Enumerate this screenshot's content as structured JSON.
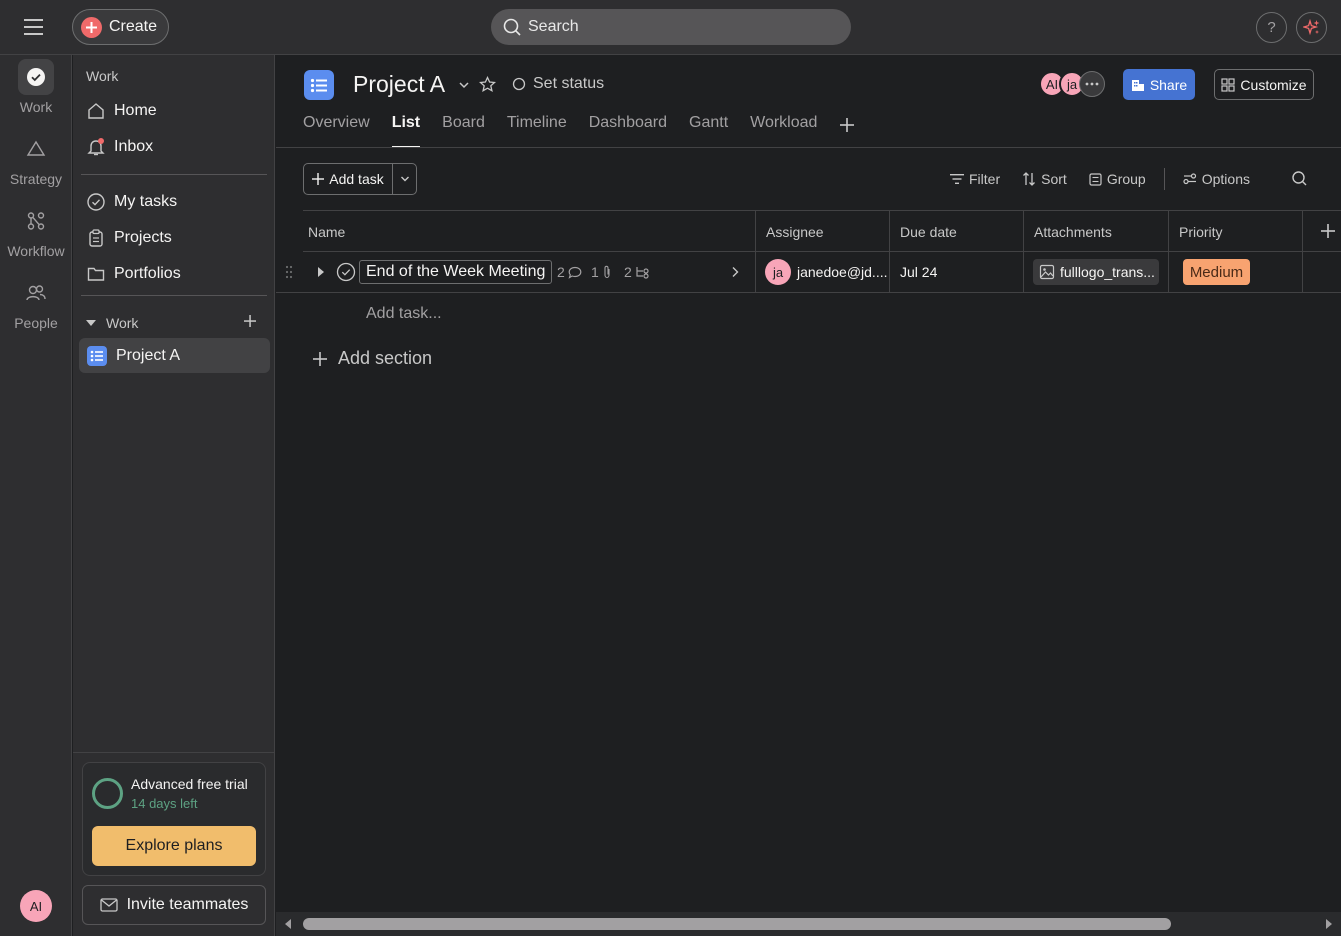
{
  "topbar": {
    "create_label": "Create",
    "search_placeholder": "Search",
    "help_label": "?"
  },
  "rail": {
    "items": [
      {
        "label": "Work",
        "icon": "check-circle-icon"
      },
      {
        "label": "Strategy",
        "icon": "triangle-icon"
      },
      {
        "label": "Workflow",
        "icon": "workflow-icon"
      },
      {
        "label": "People",
        "icon": "people-icon"
      }
    ],
    "avatar_initials": "AI"
  },
  "sidebar": {
    "heading": "Work",
    "items": [
      {
        "label": "Home",
        "icon": "home-icon"
      },
      {
        "label": "Inbox",
        "icon": "bell-icon"
      }
    ],
    "items2": [
      {
        "label": "My tasks",
        "icon": "check-circle-icon"
      },
      {
        "label": "Projects",
        "icon": "clipboard-icon"
      },
      {
        "label": "Portfolios",
        "icon": "folder-icon"
      }
    ],
    "section_label": "Work",
    "projects": [
      {
        "label": "Project A"
      }
    ],
    "trial": {
      "title": "Advanced free trial",
      "subtitle": "14 days left",
      "cta": "Explore plans"
    },
    "invite_label": "Invite teammates"
  },
  "project": {
    "title": "Project A",
    "set_status": "Set status",
    "members": [
      "AI",
      "ja"
    ],
    "share_label": "Share",
    "customize_label": "Customize",
    "tabs": [
      "Overview",
      "List",
      "Board",
      "Timeline",
      "Dashboard",
      "Gantt",
      "Workload"
    ],
    "active_tab": "List"
  },
  "toolbar": {
    "add_task_label": "Add task",
    "filter_label": "Filter",
    "sort_label": "Sort",
    "group_label": "Group",
    "options_label": "Options"
  },
  "table": {
    "columns": [
      "Name",
      "Assignee",
      "Due date",
      "Attachments",
      "Priority"
    ],
    "rows": [
      {
        "name": "End of the Week Meeting",
        "comments": "2",
        "attachments_count": "1",
        "subtasks": "2",
        "assignee_initials": "ja",
        "assignee": "janedoe@jd....",
        "due": "Jul 24",
        "attachment": "fulllogo_trans...",
        "priority": "Medium"
      }
    ],
    "add_task_placeholder": "Add task...",
    "add_section_label": "Add section"
  },
  "colors": {
    "accent_blue": "#4573d2",
    "create_red": "#f06a6a",
    "trial_green": "#5da283",
    "explore_orange": "#f1bd6c",
    "priority_medium": "#f8a370",
    "avatar_pink": "#f8a5b8"
  }
}
